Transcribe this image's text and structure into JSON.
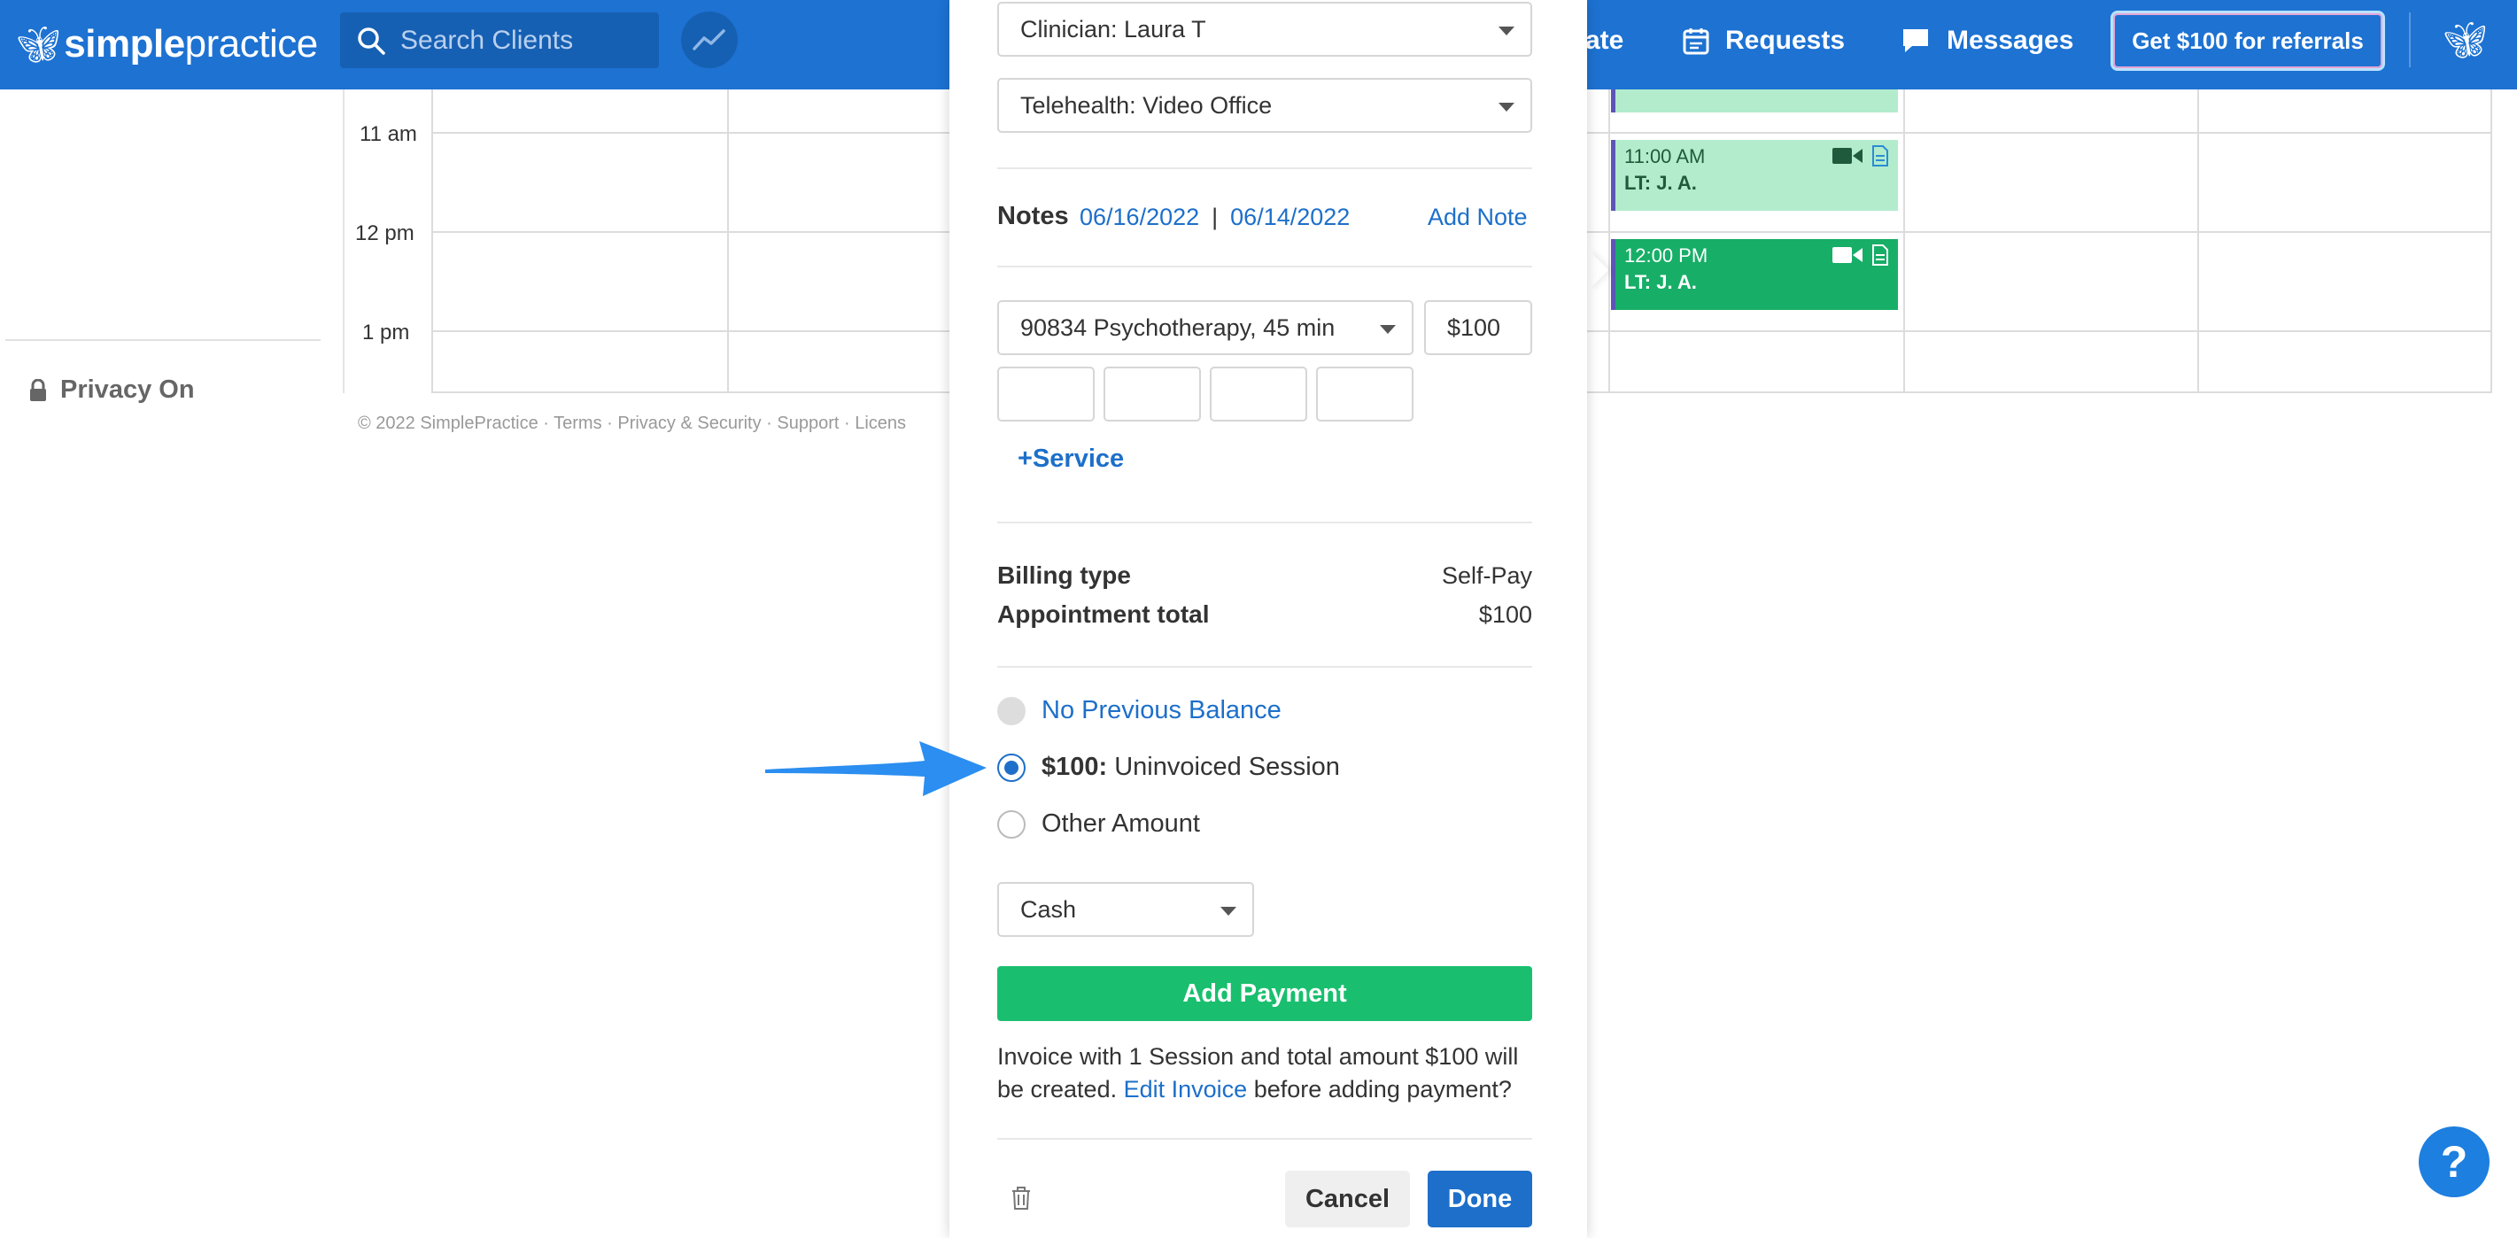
{
  "nav": {
    "logo_bold": "simple",
    "logo_light": "practice",
    "search_placeholder": "Search Clients",
    "partial_item": "ate",
    "requests": "Requests",
    "messages": "Messages",
    "referral_button": "Get $100 for referrals"
  },
  "sidebar": {
    "privacy_label": "Privacy On"
  },
  "calendar": {
    "time_labels": [
      "11 am",
      "12 pm",
      "1 pm"
    ],
    "footer": "© 2022 SimplePractice · Terms · Privacy & Security · Support · Licens",
    "appointments": [
      {
        "time": "11:00 AM",
        "client": "LT: J. A."
      },
      {
        "time": "12:00 PM",
        "client": "LT: J. A."
      }
    ]
  },
  "panel": {
    "clinician": "Clinician: Laura T",
    "location": "Telehealth: Video Office",
    "notes_title": "Notes",
    "note_dates": [
      "06/16/2022",
      "06/14/2022"
    ],
    "notes_separator": "|",
    "add_note": "Add Note",
    "service": "90834 Psychotherapy, 45 min",
    "service_fee": "$100",
    "add_service": "+Service",
    "billing_type_label": "Billing type",
    "billing_type_value": "Self-Pay",
    "appointment_total_label": "Appointment total",
    "appointment_total_value": "$100",
    "payment_options": {
      "no_balance": "No Previous Balance",
      "uninvoiced_amount": "$100:",
      "uninvoiced_label": "Uninvoiced Session",
      "other_amount": "Other Amount"
    },
    "payment_method": "Cash",
    "add_payment": "Add Payment",
    "invoice_note_before": "Invoice with 1 Session and total amount $100 will be created.",
    "invoice_note_link": "Edit Invoice",
    "invoice_note_after": "before adding payment?",
    "cancel": "Cancel",
    "done": "Done"
  },
  "help": "?",
  "colors": {
    "nav_bg": "#1d72d2",
    "link": "#1d6fc9",
    "add_payment": "#19bf6e",
    "appt_light": "#b2eccd",
    "appt_dark": "#17ae67"
  }
}
